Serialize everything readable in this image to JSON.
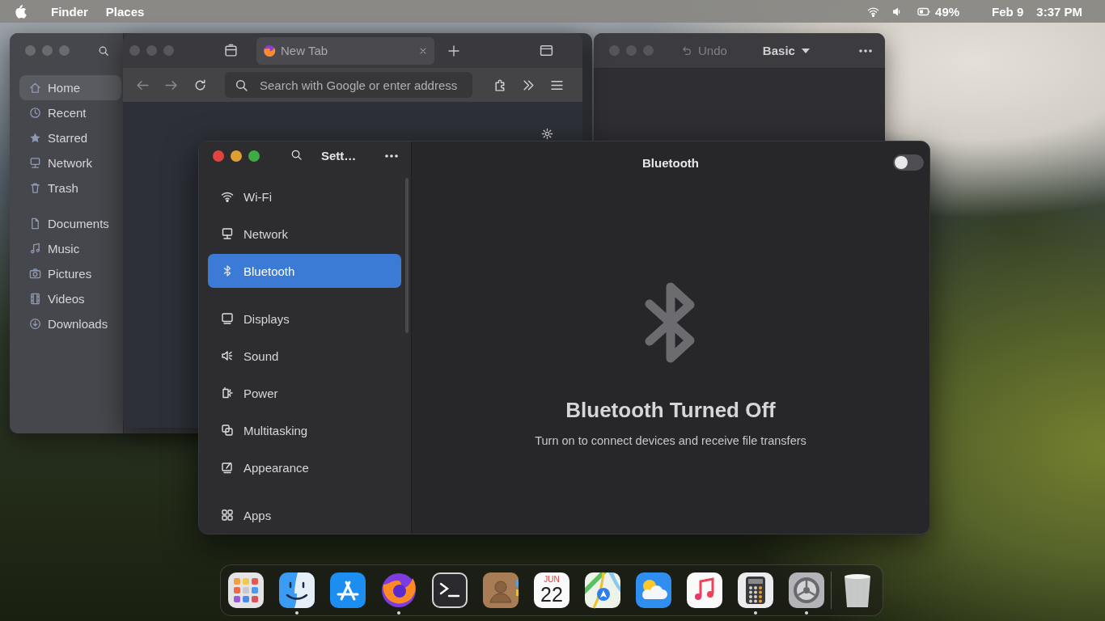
{
  "menu_bar": {
    "app_name": "Finder",
    "menus": [
      "Places"
    ],
    "battery": "49%",
    "date": "Feb 9",
    "time": "3:37 PM"
  },
  "files_window": {
    "sections": [
      {
        "items": [
          {
            "label": "Home",
            "selected": true
          },
          {
            "label": "Recent",
            "selected": false
          },
          {
            "label": "Starred",
            "selected": false
          },
          {
            "label": "Network",
            "selected": false
          },
          {
            "label": "Trash",
            "selected": false
          }
        ]
      },
      {
        "items": [
          {
            "label": "Documents",
            "selected": false
          },
          {
            "label": "Music",
            "selected": false
          },
          {
            "label": "Pictures",
            "selected": false
          },
          {
            "label": "Videos",
            "selected": false
          },
          {
            "label": "Downloads",
            "selected": false
          }
        ]
      }
    ]
  },
  "browser_window": {
    "tab_title": "New Tab",
    "address_placeholder": "Search with Google or enter address"
  },
  "calculator_window": {
    "undo": {
      "label": "Undo",
      "disabled": true
    },
    "mode": "Basic"
  },
  "settings_window": {
    "title": "Sett…",
    "sections": [
      {
        "items": [
          {
            "label": "Wi-Fi",
            "selected": false
          },
          {
            "label": "Network",
            "selected": false
          },
          {
            "label": "Bluetooth",
            "selected": true
          }
        ]
      },
      {
        "items": [
          {
            "label": "Displays",
            "selected": false
          },
          {
            "label": "Sound",
            "selected": false
          },
          {
            "label": "Power",
            "selected": false
          },
          {
            "label": "Multitasking",
            "selected": false
          },
          {
            "label": "Appearance",
            "selected": false
          }
        ]
      },
      {
        "items": [
          {
            "label": "Apps",
            "selected": false
          }
        ]
      }
    ],
    "panel_title": "Bluetooth",
    "bluetooth_on": false,
    "status_title": "Bluetooth Turned Off",
    "status_message": "Turn on to connect devices and receive file transfers"
  },
  "dock": {
    "items": [
      {
        "kind": "launchpad",
        "running": false
      },
      {
        "kind": "finder",
        "running": true
      },
      {
        "kind": "store",
        "running": false
      },
      {
        "kind": "browser",
        "running": true
      },
      {
        "kind": "terminal",
        "running": false
      },
      {
        "kind": "contacts",
        "running": false
      },
      {
        "kind": "calendar",
        "running": false,
        "month": "JUN",
        "day": "22"
      },
      {
        "kind": "maps",
        "running": false
      },
      {
        "kind": "weather",
        "running": false
      },
      {
        "kind": "music",
        "running": false
      },
      {
        "kind": "calculator",
        "running": true
      },
      {
        "kind": "settings",
        "running": true
      },
      {
        "kind": "trash",
        "running": false
      }
    ]
  }
}
